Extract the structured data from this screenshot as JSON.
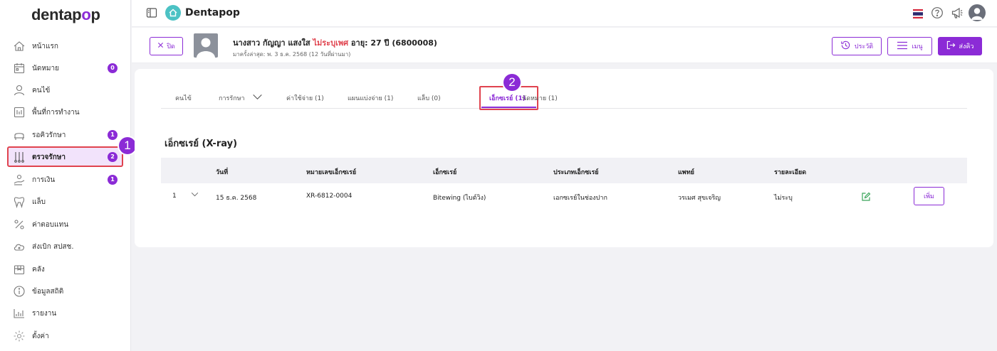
{
  "logo": {
    "main": "dentap",
    "accent": "o",
    "end": "p"
  },
  "topbar": {
    "app_title": "Dentapop"
  },
  "sidebar": {
    "items": [
      {
        "label": "หน้าแรก",
        "icon": "home-icon"
      },
      {
        "label": "นัดหมาย",
        "icon": "calendar-icon",
        "badge": "0"
      },
      {
        "label": "คนไข้",
        "icon": "user-icon"
      },
      {
        "label": "พื้นที่การทำงาน",
        "icon": "workspace-icon"
      },
      {
        "label": "รอคิวรักษา",
        "icon": "queue-icon",
        "badge": "1"
      },
      {
        "label": "ตรวจรักษา",
        "icon": "treatment-icon",
        "badge": "2"
      },
      {
        "label": "การเงิน",
        "icon": "finance-icon",
        "badge": "1"
      },
      {
        "label": "แล็บ",
        "icon": "tooth-icon"
      },
      {
        "label": "ค่าตอบแทน",
        "icon": "percent-icon"
      },
      {
        "label": "ส่งเบิก สปสช.",
        "icon": "cloud-icon"
      },
      {
        "label": "คลัง",
        "icon": "box-icon"
      },
      {
        "label": "ข้อมูลสถิติ",
        "icon": "info-icon"
      },
      {
        "label": "รายงาน",
        "icon": "report-icon"
      },
      {
        "label": "ตั้งค่า",
        "icon": "gear-icon"
      }
    ]
  },
  "callouts": {
    "one": "1",
    "two": "2"
  },
  "patient": {
    "close_label": "ปิด",
    "name": "นางสาว กัญญา แสงใส",
    "gender": "ไม่ระบุเพศ",
    "age_id": "อายุ: 27 ปี  (6800008)",
    "last_visit": "มาครั้งล่าสุด: พ. 3 ธ.ค. 2568 (12 วันที่ผ่านมา)",
    "history_label": "ประวัติ",
    "menu_label": "เมนู",
    "send_queue_label": "ส่งคิว"
  },
  "tabs": [
    {
      "label": "คนไข้"
    },
    {
      "label": "การรักษา"
    },
    {
      "label": "ค่าใช้จ่าย (1)"
    },
    {
      "label": "แผนแบ่งจ่าย (1)"
    },
    {
      "label": "แล็บ (0)"
    },
    {
      "label": "เอ็กซเรย์ (1)"
    },
    {
      "label": "นัดหมาย (1)"
    }
  ],
  "section_title": "เอ็กซเรย์ (X-ray)",
  "table": {
    "headers": [
      "วันที่",
      "หมายเลขเอ็กซเรย์",
      "เอ็กซเรย์",
      "ประเภทเอ็กซเรย์",
      "แพทย์",
      "รายละเอียด"
    ],
    "rows": [
      {
        "no": "1",
        "date": "15 ธ.ค. 2568",
        "xray_no": "XR-6812-0004",
        "xray": "Bitewing (ไบต์วิง)",
        "type": "เอกซเรย์ในช่องปาก",
        "doctor": "วรเมศ สุขเจริญ",
        "detail": "ไม่ระบุ",
        "add_label": "เพิ่ม"
      }
    ]
  },
  "colors": {
    "accent": "#8b2bd6",
    "highlight": "#e0434e",
    "teal": "#4cc2c4"
  }
}
